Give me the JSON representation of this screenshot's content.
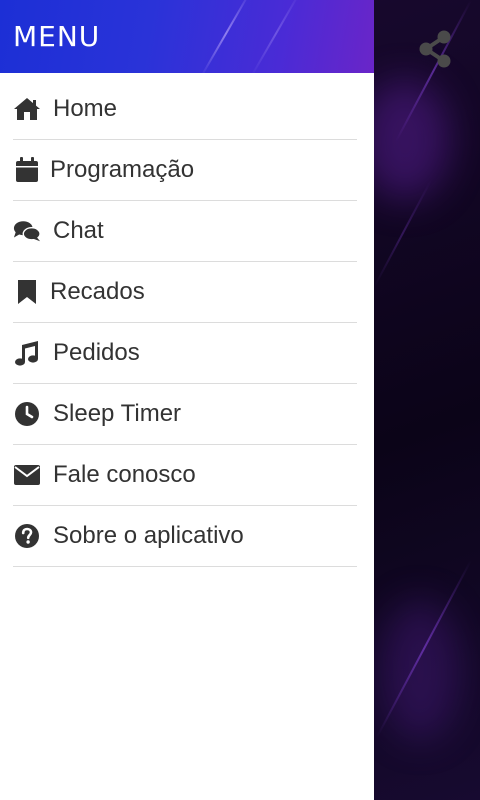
{
  "drawer": {
    "title": "MENU",
    "header_gradient": [
      "#1c2fd6",
      "#6a25c8"
    ],
    "items": [
      {
        "label": "Home",
        "icon": "home-icon"
      },
      {
        "label": "Programação",
        "icon": "calendar-icon"
      },
      {
        "label": "Chat",
        "icon": "chat-bubbles-icon"
      },
      {
        "label": "Recados",
        "icon": "bookmark-icon"
      },
      {
        "label": "Pedidos",
        "icon": "music-note-icon"
      },
      {
        "label": "Sleep Timer",
        "icon": "clock-icon"
      },
      {
        "label": "Fale conosco",
        "icon": "envelope-icon"
      },
      {
        "label": "Sobre o aplicativo",
        "icon": "question-circle-icon"
      }
    ]
  },
  "app": {
    "share_icon": "share-icon",
    "background_color": "#120624"
  },
  "colors": {
    "menu_text": "#333333",
    "divider": "#dcdcdc"
  }
}
